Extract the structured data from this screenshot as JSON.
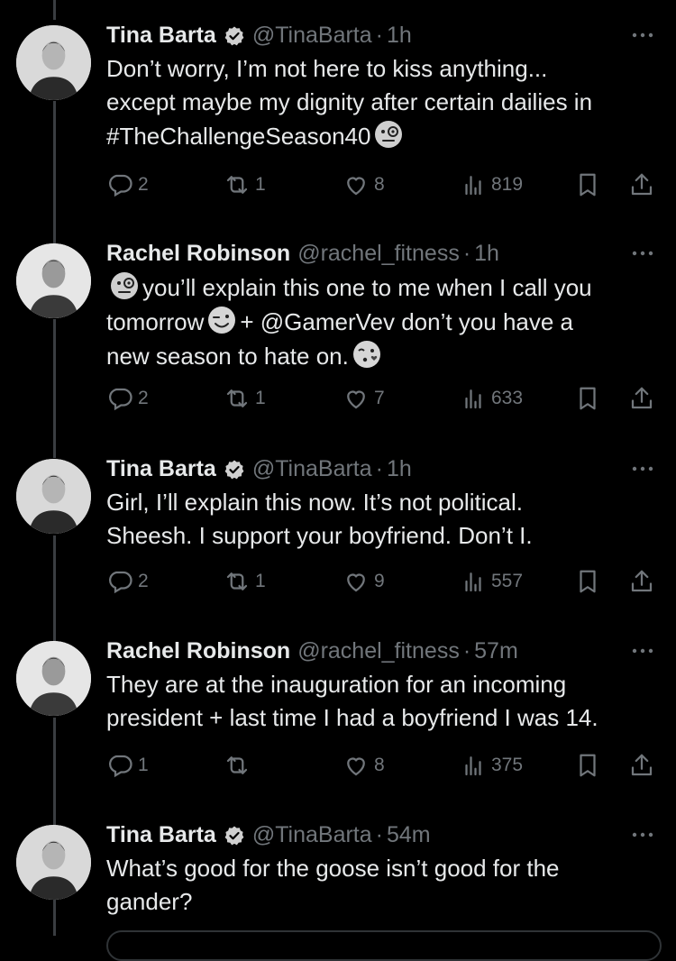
{
  "tweets": [
    {
      "name": "Tina Barta",
      "verified": true,
      "handle": "@TinaBarta",
      "time": "1h",
      "lines": [
        [
          "Don’t worry, I’m not here to kiss anything..."
        ],
        [
          "except maybe my dignity after certain dailies in"
        ],
        [
          "#TheChallengeSeason40",
          "emoji:face-with-monocle"
        ]
      ],
      "replies": "2",
      "reposts": "1",
      "likes": "8",
      "views": "819"
    },
    {
      "name": "Rachel Robinson",
      "verified": false,
      "handle": "@rachel_fitness",
      "time": "1h",
      "lines": [
        [
          "emoji:face-with-monocle",
          "you’ll explain this one to me when I call you"
        ],
        [
          "tomorrow",
          "emoji:winking-face",
          "+ @GamerVev don’t you have a"
        ],
        [
          "new season to hate on.",
          "emoji:face-blowing-kiss"
        ]
      ],
      "replies": "2",
      "reposts": "1",
      "likes": "7",
      "views": "633"
    },
    {
      "name": "Tina Barta",
      "verified": true,
      "handle": "@TinaBarta",
      "time": "1h",
      "lines": [
        [
          "Girl, I’ll explain this now.  It’s not political."
        ],
        [
          "Sheesh.  I support your boyfriend.  Don’t I."
        ]
      ],
      "replies": "2",
      "reposts": "1",
      "likes": "9",
      "views": "557"
    },
    {
      "name": "Rachel Robinson",
      "verified": false,
      "handle": "@rachel_fitness",
      "time": "57m",
      "lines": [
        [
          "They are at the inauguration for an incoming"
        ],
        [
          "president + last time I had a boyfriend I was 14."
        ]
      ],
      "replies": "1",
      "reposts": "",
      "likes": "8",
      "views": "375"
    },
    {
      "name": "Tina Barta",
      "verified": true,
      "handle": "@TinaBarta",
      "time": "54m",
      "lines": [
        [
          "What’s good for the goose isn’t good for the"
        ],
        [
          "gander?"
        ]
      ],
      "replies": "",
      "reposts": "",
      "likes": "",
      "views": ""
    }
  ],
  "colors": {
    "background": "#000000",
    "text": "#e7e9ea",
    "secondary": "#71767b",
    "thread_line": "#3a3d41"
  }
}
